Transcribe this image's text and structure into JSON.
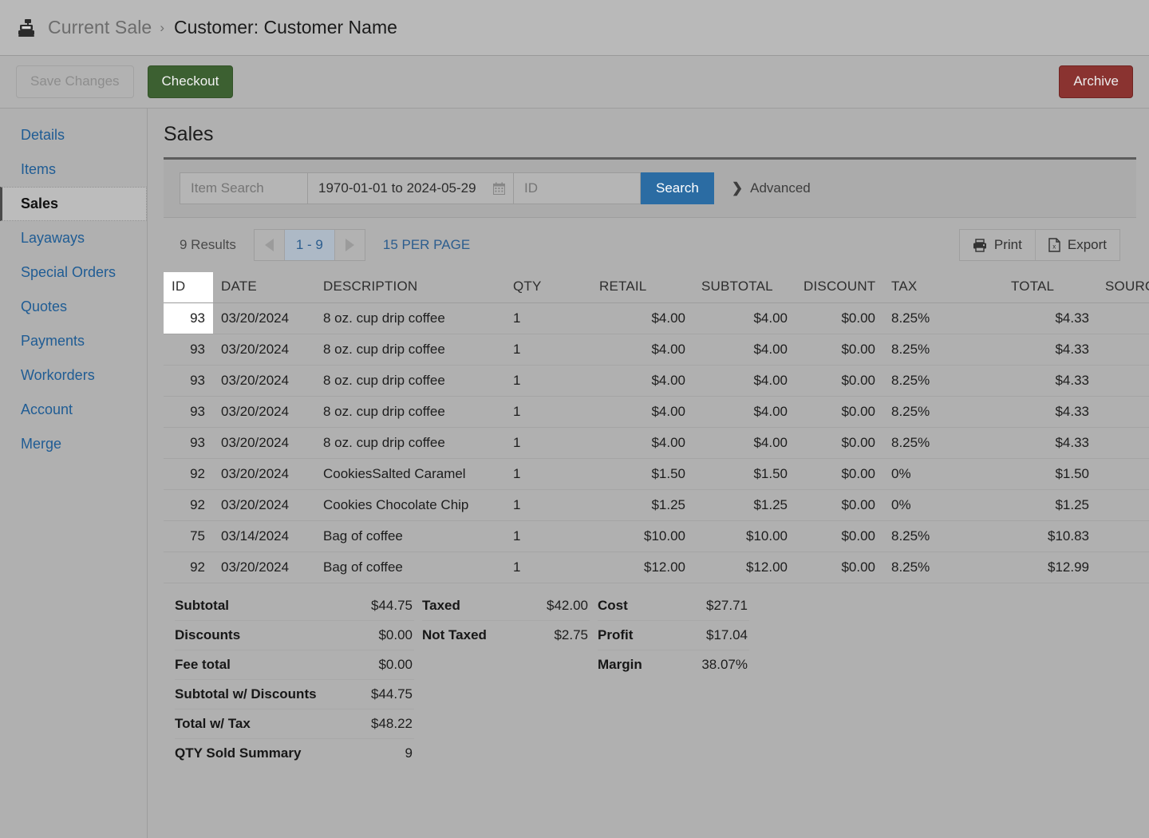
{
  "topbar": {
    "icon": "cash-register-icon",
    "breadcrumb_root": "Current Sale",
    "breadcrumb_separator": "›",
    "breadcrumb_current": "Customer: Customer Name"
  },
  "actionbar": {
    "save_label": "Save Changes",
    "checkout_label": "Checkout",
    "archive_label": "Archive",
    "checkout_color": "#3c6031",
    "archive_color": "#8a3330"
  },
  "sidebar": {
    "items": [
      {
        "label": "Details",
        "active": false
      },
      {
        "label": "Items",
        "active": false
      },
      {
        "label": "Sales",
        "active": true
      },
      {
        "label": "Layaways",
        "active": false
      },
      {
        "label": "Special Orders",
        "active": false
      },
      {
        "label": "Quotes",
        "active": false
      },
      {
        "label": "Payments",
        "active": false
      },
      {
        "label": "Workorders",
        "active": false
      },
      {
        "label": "Account",
        "active": false
      },
      {
        "label": "Merge",
        "active": false
      }
    ]
  },
  "main": {
    "title": "Sales",
    "search": {
      "item_placeholder": "Item Search",
      "item_value": "",
      "date_range_value": "1970-01-01 to 2024-05-29",
      "calendar_icon": "calendar-icon",
      "id_placeholder": "ID",
      "id_value": "",
      "search_label": "Search",
      "search_color": "#2b6ca3",
      "advanced_label": "Advanced",
      "advanced_icon": "chevron-right-icon"
    },
    "results": {
      "count_label": "9 Results",
      "prev_icon": "triangle-left-icon",
      "page_label": "1 - 9",
      "next_icon": "triangle-right-icon",
      "per_page_label": "15 PER PAGE",
      "print_label": "Print",
      "print_icon": "printer-icon",
      "export_label": "Export",
      "export_icon": "excel-file-icon"
    },
    "table": {
      "columns": [
        "ID",
        "DATE",
        "DESCRIPTION",
        "QTY",
        "RETAIL",
        "SUBTOTAL",
        "DISCOUNT",
        "TAX",
        "TOTAL",
        "SOURCE"
      ],
      "rows": [
        {
          "id": "93",
          "date": "03/20/2024",
          "description": "8 oz. cup drip coffee",
          "qty": "1",
          "retail": "$4.00",
          "subtotal": "$4.00",
          "discount": "$0.00",
          "tax": "8.25%",
          "total": "$4.33",
          "source": ""
        },
        {
          "id": "93",
          "date": "03/20/2024",
          "description": "8 oz. cup drip coffee",
          "qty": "1",
          "retail": "$4.00",
          "subtotal": "$4.00",
          "discount": "$0.00",
          "tax": "8.25%",
          "total": "$4.33",
          "source": ""
        },
        {
          "id": "93",
          "date": "03/20/2024",
          "description": "8 oz. cup drip coffee",
          "qty": "1",
          "retail": "$4.00",
          "subtotal": "$4.00",
          "discount": "$0.00",
          "tax": "8.25%",
          "total": "$4.33",
          "source": ""
        },
        {
          "id": "93",
          "date": "03/20/2024",
          "description": "8 oz. cup drip coffee",
          "qty": "1",
          "retail": "$4.00",
          "subtotal": "$4.00",
          "discount": "$0.00",
          "tax": "8.25%",
          "total": "$4.33",
          "source": ""
        },
        {
          "id": "93",
          "date": "03/20/2024",
          "description": "8 oz. cup drip coffee",
          "qty": "1",
          "retail": "$4.00",
          "subtotal": "$4.00",
          "discount": "$0.00",
          "tax": "8.25%",
          "total": "$4.33",
          "source": ""
        },
        {
          "id": "92",
          "date": "03/20/2024",
          "description": "CookiesSalted Caramel",
          "qty": "1",
          "retail": "$1.50",
          "subtotal": "$1.50",
          "discount": "$0.00",
          "tax": "0%",
          "total": "$1.50",
          "source": ""
        },
        {
          "id": "92",
          "date": "03/20/2024",
          "description": "Cookies Chocolate Chip",
          "qty": "1",
          "retail": "$1.25",
          "subtotal": "$1.25",
          "discount": "$0.00",
          "tax": "0%",
          "total": "$1.25",
          "source": ""
        },
        {
          "id": "75",
          "date": "03/14/2024",
          "description": "Bag of coffee",
          "qty": "1",
          "retail": "$10.00",
          "subtotal": "$10.00",
          "discount": "$0.00",
          "tax": "8.25%",
          "total": "$10.83",
          "source": ""
        },
        {
          "id": "92",
          "date": "03/20/2024",
          "description": "Bag of coffee",
          "qty": "1",
          "retail": "$12.00",
          "subtotal": "$12.00",
          "discount": "$0.00",
          "tax": "8.25%",
          "total": "$12.99",
          "source": ""
        }
      ]
    },
    "totals": {
      "column1": [
        {
          "label": "Subtotal",
          "value": "$44.75"
        },
        {
          "label": "Discounts",
          "value": "$0.00"
        },
        {
          "label": "Fee total",
          "value": "$0.00"
        },
        {
          "label": "Subtotal w/ Discounts",
          "value": "$44.75"
        },
        {
          "label": "Total w/ Tax",
          "value": "$48.22"
        },
        {
          "label": "QTY Sold Summary",
          "value": "9"
        }
      ],
      "column2": [
        {
          "label": "Taxed",
          "value": "$42.00"
        },
        {
          "label": "Not Taxed",
          "value": "$2.75"
        }
      ],
      "column3": [
        {
          "label": "Cost",
          "value": "$27.71"
        },
        {
          "label": "Profit",
          "value": "$17.04"
        },
        {
          "label": "Margin",
          "value": "38.07%"
        }
      ]
    }
  }
}
